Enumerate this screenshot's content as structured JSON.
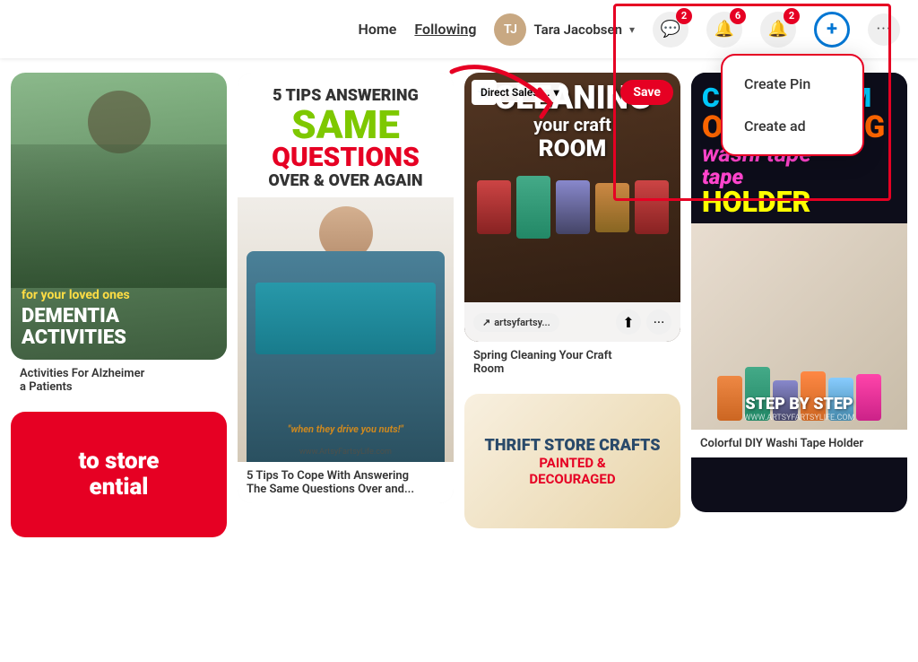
{
  "navbar": {
    "home_label": "Home",
    "following_label": "Following",
    "user_name": "Tara Jacobsen",
    "messages_badge": "2",
    "notifications_badge": "6",
    "updates_badge": "2"
  },
  "dropdown": {
    "create_pin": "Create Pin",
    "create_ad": "Create ad"
  },
  "pins": {
    "col1": {
      "card1": {
        "subtitle": "for your loved ones",
        "title": "DEMENTIA",
        "title2": "ACTIVITIES"
      },
      "card2": {
        "caption1": "Activities For Alzheimer",
        "caption2": "a Patients"
      },
      "card3": {
        "text1": "to store",
        "text2": "ential"
      }
    },
    "col2": {
      "card1": {
        "headline": "5 TIPS ANSWERING",
        "same": "SAME",
        "questions": "QUESTIONS",
        "over": "OVER & OVER AGAIN",
        "watermark": "www.ArtsyFartsyLife.com",
        "caption1": "5 Tips To Cope With Answering",
        "caption2": "The Same Questions Over and..."
      }
    },
    "col3": {
      "card1": {
        "board": "Direct Sales ...",
        "save": "Save",
        "big_text": "CLEANING",
        "sub_text": "your craft",
        "sub_text2": "ROOM",
        "source": "artsyfartsy...",
        "caption1": "Spring Cleaning Your Craft",
        "caption2": "Room"
      },
      "card2": {
        "title": "THRIFT STORE CRAFTS",
        "sub": "PAINTED &",
        "sub2": "DECOURAGED"
      }
    },
    "col4": {
      "card1": {
        "line1": "CRAFT ROOM",
        "line2": "ORGANIZING",
        "line3": "washi tape",
        "line4": "holder",
        "step": "STEP BY STEP",
        "website": "WWW.ARTSYFARTSYLIFE.COM",
        "caption": "Colorful DIY Washi Tape Holder"
      }
    }
  },
  "colors": {
    "pinterest_red": "#e60023",
    "accent_blue": "#0076d3",
    "green_text": "#7ec800",
    "cyan_text": "#00ccff",
    "orange_text": "#ff6600",
    "pink_text": "#ff44cc",
    "yellow_text": "#ffff00"
  }
}
